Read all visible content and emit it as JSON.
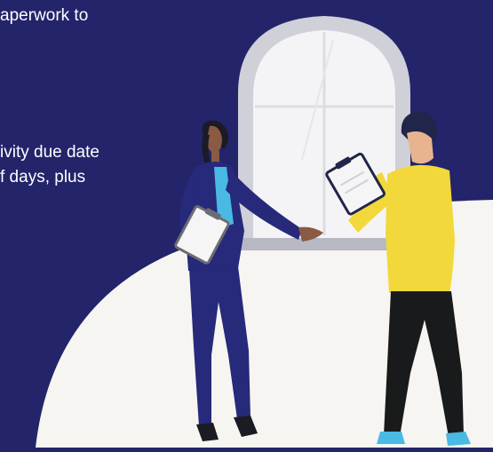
{
  "body_text": {
    "line_1": "aperwork to",
    "line_2": "ivity due date",
    "line_3": "f days, plus"
  },
  "illustration": {
    "subject": "two professionals reviewing clipboards in front of an arched window",
    "icons": [
      "arched-window-illustration",
      "woman-with-clipboard-illustration",
      "man-with-clipboard-illustration"
    ]
  },
  "colors": {
    "background": "#23246a",
    "foreground_curve": "#f6f5f1",
    "window_frame": "#d8d9df",
    "woman_suit": "#2a2c78",
    "man_shirt": "#f2d83a",
    "text": "#ffffff"
  }
}
